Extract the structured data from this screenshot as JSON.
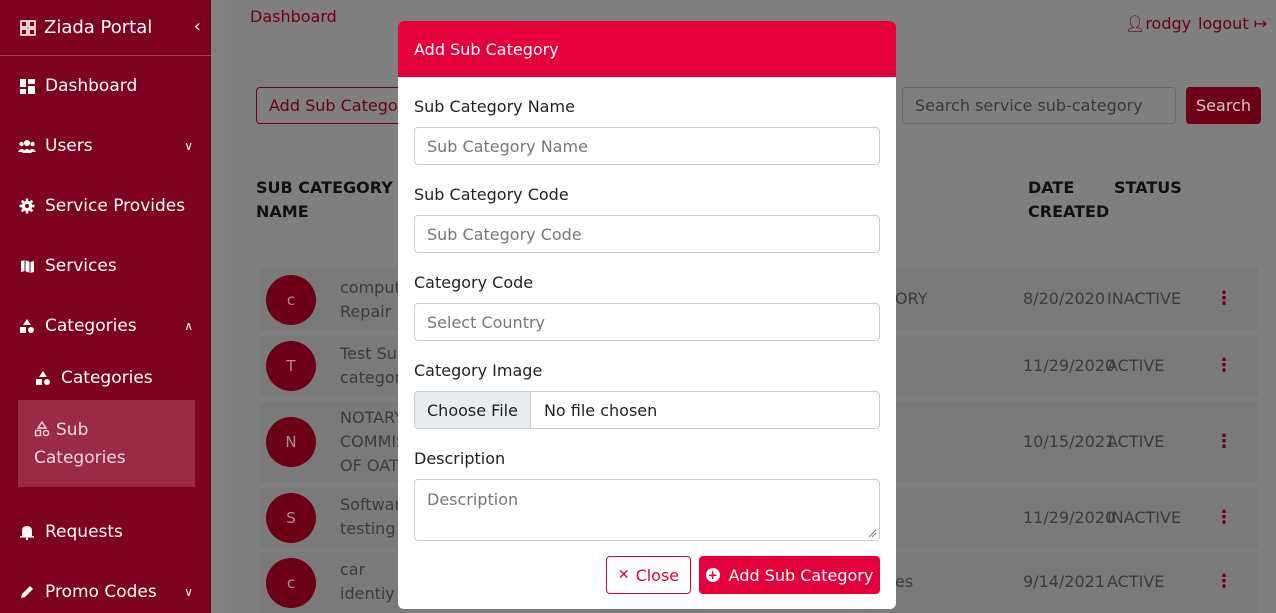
{
  "sidebar": {
    "brand": "Ziada Portal",
    "items": [
      {
        "label": "Dashboard",
        "icon": "dashboard-icon"
      },
      {
        "label": "Users",
        "icon": "users-icon"
      },
      {
        "label": "Service Provides",
        "icon": "gear-icon"
      },
      {
        "label": "Services",
        "icon": "map-icon"
      },
      {
        "label": "Categories",
        "icon": "shapes-icon"
      },
      {
        "label": "Requests",
        "icon": "bell-icon"
      },
      {
        "label": "Promo Codes",
        "icon": "pencil-icon"
      }
    ],
    "sub_items": [
      {
        "label": "Categories"
      },
      {
        "label": "Sub Categories"
      }
    ]
  },
  "header": {
    "breadcrumb": "Dashboard",
    "user": "rodgy",
    "logout": "logout"
  },
  "toolbar": {
    "add_label": "Add Sub Category",
    "search_placeholder": "Search service sub-category",
    "search_label": "Search"
  },
  "table": {
    "headers": {
      "name": "SUB CATEGORY NAME",
      "date": "DATE CREATED",
      "status": "STATUS"
    },
    "rows": [
      {
        "initial": "c",
        "name1": "computer",
        "name2": "Repair",
        "mid": "ORY",
        "date": "8/20/2020",
        "status": "INACTIVE"
      },
      {
        "initial": "T",
        "name1": "Test Sub",
        "name2": "category",
        "mid": "",
        "date": "11/29/2020",
        "status": "ACTIVE"
      },
      {
        "initial": "N",
        "name1": "NOTARY",
        "name2": "COMMIS",
        "name3": "OF OATH",
        "mid": "",
        "date": "10/15/2021",
        "status": "ACTIVE"
      },
      {
        "initial": "S",
        "name1": "Software",
        "name2": "testing",
        "mid": "",
        "date": "11/29/2020",
        "status": "INACTIVE"
      },
      {
        "initial": "c",
        "name1": "car",
        "name2": "identiy",
        "mid": "es",
        "date": "9/14/2021",
        "status": "ACTIVE"
      }
    ]
  },
  "modal": {
    "title": "Add Sub Category",
    "fields": {
      "name_label": "Sub Category Name",
      "name_placeholder": "Sub Category Name",
      "code_label": "Sub Category Code",
      "code_placeholder": "Sub Category Code",
      "category_label": "Category Code",
      "category_placeholder": "Select Country",
      "image_label": "Category Image",
      "choose_file": "Choose File",
      "no_file": "No file chosen",
      "description_label": "Description",
      "description_placeholder": "Description"
    },
    "close_label": "Close",
    "submit_label": "Add Sub Category"
  },
  "colors": {
    "primary": "#e4003a",
    "sidebar": "#7e0120"
  }
}
